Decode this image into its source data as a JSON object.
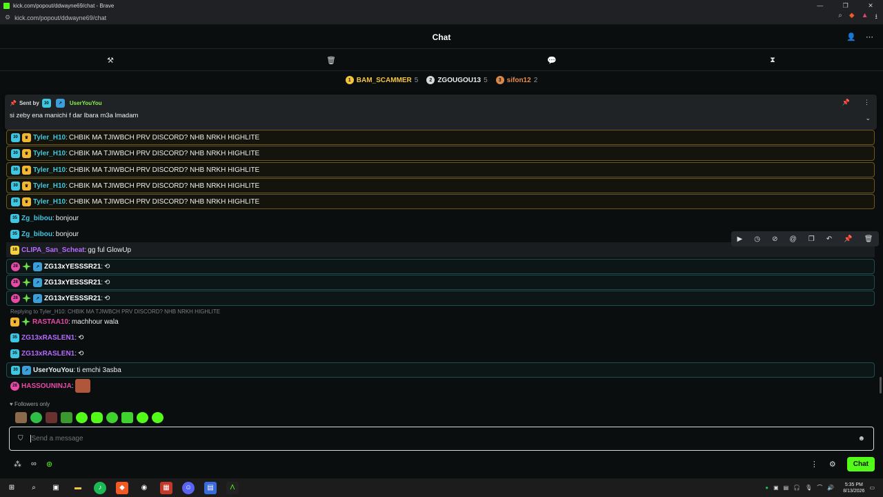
{
  "browser": {
    "window_title": "kick.com/popout/ddwayne69/chat - Brave",
    "url": "kick.com/popout/ddwayne69/chat"
  },
  "header": {
    "title": "Chat"
  },
  "leaderboard": [
    {
      "rank": "1",
      "name": "BAM_SCAMMER",
      "count": "5",
      "color": "#f2c53d",
      "rank_color": "#f2c53d"
    },
    {
      "rank": "2",
      "name": "ZGOUGOU13",
      "count": "5",
      "color": "#e9ecec",
      "rank_color": "#d9d9d9"
    },
    {
      "rank": "3",
      "name": "sifon12",
      "count": "2",
      "color": "#e88a4c",
      "rank_color": "#d98a4a"
    }
  ],
  "pinned": {
    "sent_by_label": "Sent by",
    "sender": "UserYouYou",
    "sender_badge": "30",
    "sender_color": "#8cf04e",
    "message": "si zeby ena manichi f dar lbara m3a lmadam"
  },
  "messages": [
    {
      "badges": [
        "30",
        "crown"
      ],
      "user": "Tyler_H10",
      "color": "#3ec7e2",
      "text": "CHBIK MA TJIWBCH PRV DISCORD? NHB NRKH HIGHLITE",
      "style": "hl-yellow"
    },
    {
      "badges": [
        "30",
        "crown"
      ],
      "user": "Tyler_H10",
      "color": "#3ec7e2",
      "text": "CHBIK MA TJIWBCH PRV DISCORD? NHB NRKH HIGHLITE",
      "style": "hl-yellow"
    },
    {
      "badges": [
        "30",
        "crown"
      ],
      "user": "Tyler_H10",
      "color": "#3ec7e2",
      "text": "CHBIK MA TJIWBCH PRV DISCORD? NHB NRKH HIGHLITE",
      "style": "hl-yellow"
    },
    {
      "badges": [
        "30",
        "crown"
      ],
      "user": "Tyler_H10",
      "color": "#3ec7e2",
      "text": "CHBIK MA TJIWBCH PRV DISCORD? NHB NRKH HIGHLITE",
      "style": "hl-yellow"
    },
    {
      "badges": [
        "30",
        "crown"
      ],
      "user": "Tyler_H10",
      "color": "#3ec7e2",
      "text": "CHBIK MA TJIWBCH PRV DISCORD? NHB NRKH HIGHLITE",
      "style": "hl-yellow"
    },
    {
      "badges": [
        "35"
      ],
      "user": "Zg_bibou",
      "color": "#3ec7e2",
      "text": "bonjour",
      "style": ""
    },
    {
      "badges": [
        "35"
      ],
      "user": "Zg_bibou",
      "color": "#3ec7e2",
      "text": "bonjour",
      "style": ""
    },
    {
      "badges": [
        "18"
      ],
      "user": "CLIPA_San_Scheat",
      "color": "#b56bff",
      "text": "gg ful GlowUp",
      "style": "hover"
    },
    {
      "badges": [
        "28",
        "green",
        "blue"
      ],
      "user": "ZG13xYESSSR21",
      "color": "#ffffff",
      "text": "⟲",
      "style": "hl-teal"
    },
    {
      "badges": [
        "28",
        "green",
        "blue"
      ],
      "user": "ZG13xYESSSR21",
      "color": "#ffffff",
      "text": "⟲",
      "style": "hl-teal"
    },
    {
      "badges": [
        "28",
        "green",
        "blue"
      ],
      "user": "ZG13xYESSSR21",
      "color": "#ffffff",
      "text": "⟲",
      "style": "hl-teal"
    },
    {
      "badges": [
        "crown",
        "green"
      ],
      "user": "RASTAA10",
      "color": "#e84aa8",
      "text": "machhour wala",
      "style": ""
    },
    {
      "badges": [
        "35"
      ],
      "user": "ZG13xRASLEN1",
      "color": "#b56bff",
      "text": "⟲",
      "style": ""
    },
    {
      "badges": [
        "35"
      ],
      "user": "ZG13xRASLEN1",
      "color": "#b56bff",
      "text": "⟲",
      "style": ""
    },
    {
      "badges": [
        "30",
        "blue"
      ],
      "user": "UserYouYou",
      "color": "#e9ecec",
      "text": "ti emchi 3asba",
      "style": "hl-teal"
    },
    {
      "badges": [
        "28"
      ],
      "user": "HASSOUNINJA",
      "color": "#e84aa8",
      "text": "",
      "style": ""
    }
  ],
  "reply": {
    "text": "Replying to Tyler_H10: CHBIK MA TJIWBCH PRV DISCORD? NHB NRKH HIGHLITE"
  },
  "followers_only": "Followers only",
  "input": {
    "placeholder": "Send a message"
  },
  "send_button": "Chat",
  "clock": {
    "time": "5:35 PM",
    "date": "8/13/2026"
  }
}
